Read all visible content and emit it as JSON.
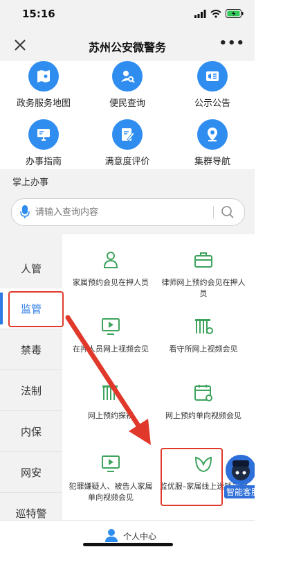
{
  "status": {
    "time": "15:16"
  },
  "nav": {
    "title": "苏州公安微警务",
    "more": "•••"
  },
  "services": [
    {
      "label": "政务服务地图",
      "icon": "map-icon"
    },
    {
      "label": "便民查询",
      "icon": "person-search-icon"
    },
    {
      "label": "公示公告",
      "icon": "announcement-icon"
    },
    {
      "label": "办事指南",
      "icon": "guide-icon"
    },
    {
      "label": "满意度评价",
      "icon": "edit-icon"
    },
    {
      "label": "集群导航",
      "icon": "location-icon"
    }
  ],
  "section": {
    "title": "掌上办事"
  },
  "search": {
    "placeholder": "请输入查询内容"
  },
  "sidebar": {
    "items": [
      {
        "label": "人管"
      },
      {
        "label": "监管"
      },
      {
        "label": "禁毒"
      },
      {
        "label": "法制"
      },
      {
        "label": "内保"
      },
      {
        "label": "网安"
      },
      {
        "label": "巡特警"
      }
    ],
    "active": "监管"
  },
  "content": {
    "items": [
      {
        "label": "家属预约会见在押人员",
        "icon": "person-icon"
      },
      {
        "label": "律师网上预约会见在押人员",
        "icon": "briefcase-icon"
      },
      {
        "label": "在押人员网上视频会见",
        "icon": "video-icon"
      },
      {
        "label": "看守所网上视频会见",
        "icon": "prison-icon"
      },
      {
        "label": "网上预约探视",
        "icon": "prison-icon"
      },
      {
        "label": "网上预约单向视频会见",
        "icon": "calendar-icon"
      },
      {
        "label": "犯罪嫌疑人、被告人家属单向视频会见",
        "icon": "video-icon"
      },
      {
        "label": "监优服–家属线上送钱送物",
        "icon": "leaf-icon"
      }
    ]
  },
  "assistant": {
    "label": "智能客服"
  },
  "bottom": {
    "label": "个人中心"
  },
  "colors": {
    "accent": "#2b7ae6",
    "icon_bg": "#2f8df0",
    "green": "#3da35d",
    "highlight": "#e0392b"
  }
}
